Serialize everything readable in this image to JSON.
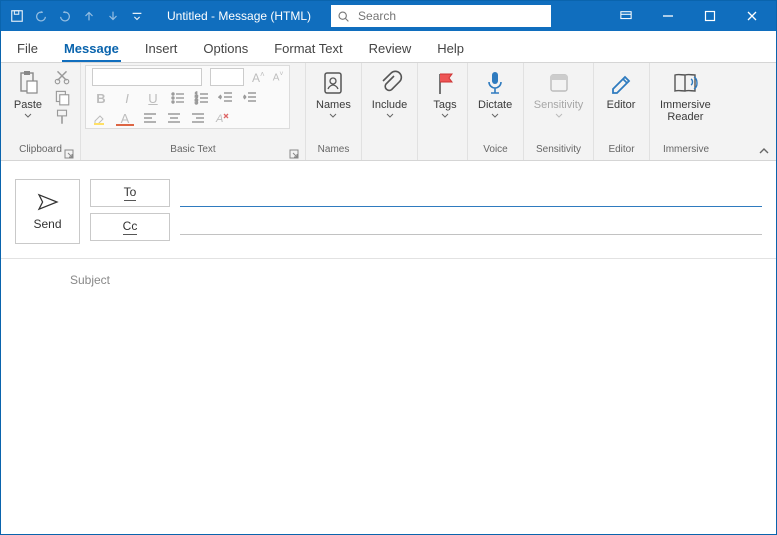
{
  "titlebar": {
    "title": "Untitled  -  Message (HTML)",
    "search_placeholder": "Search"
  },
  "tabs": {
    "file": "File",
    "message": "Message",
    "insert": "Insert",
    "options": "Options",
    "format_text": "Format Text",
    "review": "Review",
    "help": "Help",
    "active": "message"
  },
  "ribbon": {
    "clipboard": {
      "paste": "Paste",
      "group": "Clipboard"
    },
    "basic_text": {
      "group": "Basic Text"
    },
    "names": {
      "label": "Names",
      "group": "Names"
    },
    "include": {
      "label": "Include"
    },
    "tags": {
      "label": "Tags"
    },
    "dictate": {
      "label": "Dictate",
      "group": "Voice"
    },
    "sensitivity": {
      "label": "Sensitivity",
      "group": "Sensitivity"
    },
    "editor": {
      "label": "Editor",
      "group": "Editor"
    },
    "immersive": {
      "label": "Immersive\nReader",
      "group": "Immersive"
    }
  },
  "compose": {
    "send": "Send",
    "to": "To",
    "cc": "Cc",
    "subject": "Subject",
    "to_value": "",
    "cc_value": "",
    "subject_value": ""
  }
}
